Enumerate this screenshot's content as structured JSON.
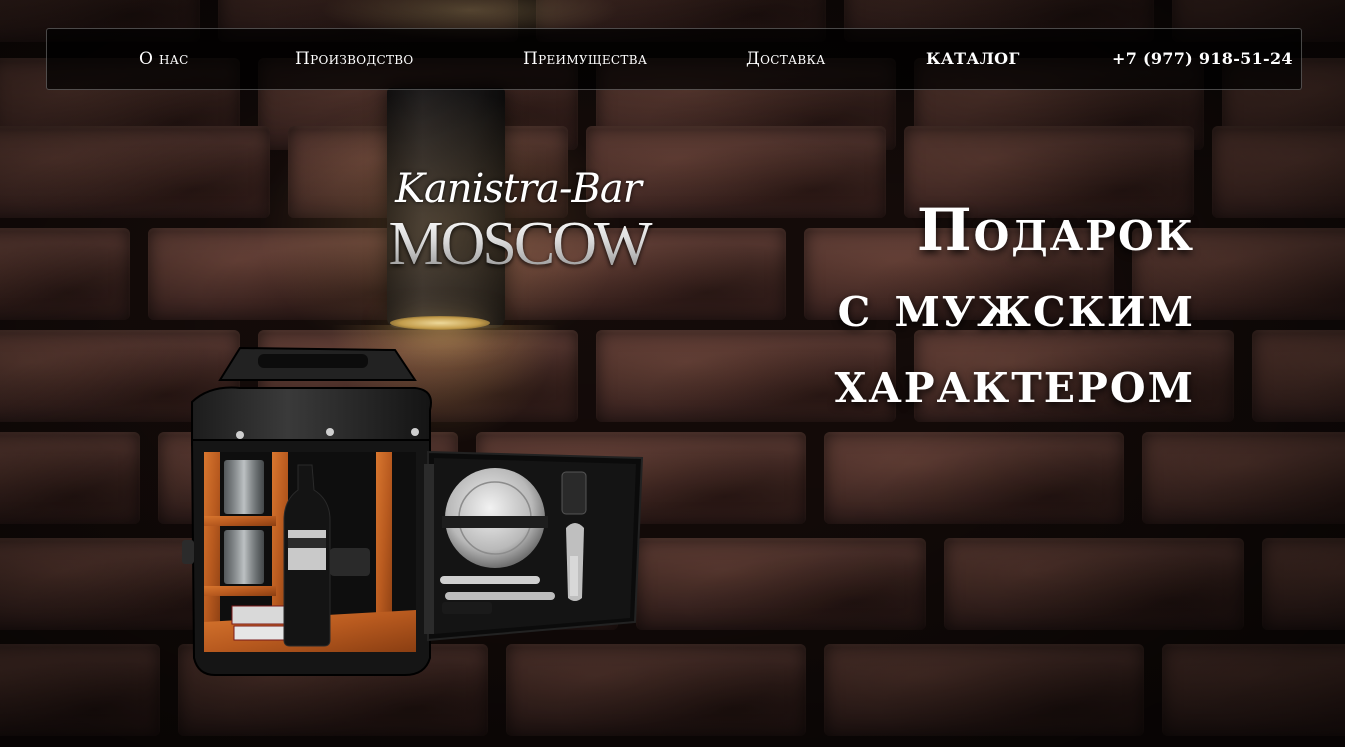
{
  "nav": {
    "items": [
      {
        "label": "О нас"
      },
      {
        "label": "Производство"
      },
      {
        "label": "Преимущества"
      },
      {
        "label": "Доставка"
      },
      {
        "label": "КАТАЛОГ"
      }
    ],
    "phone": "+7 (977) 918-51-24"
  },
  "logo": {
    "script": "Kanistra-Bar",
    "main": "MOSCOW"
  },
  "hero": {
    "lines": [
      "Подарок",
      "с мужским",
      "характером"
    ]
  },
  "icons": {
    "product": "jerrycan-bar-icon",
    "lamp": "wall-lamp-icon"
  },
  "colors": {
    "text": "#ffffff",
    "nav_background": "#000000",
    "brick": "#4a2e28"
  }
}
